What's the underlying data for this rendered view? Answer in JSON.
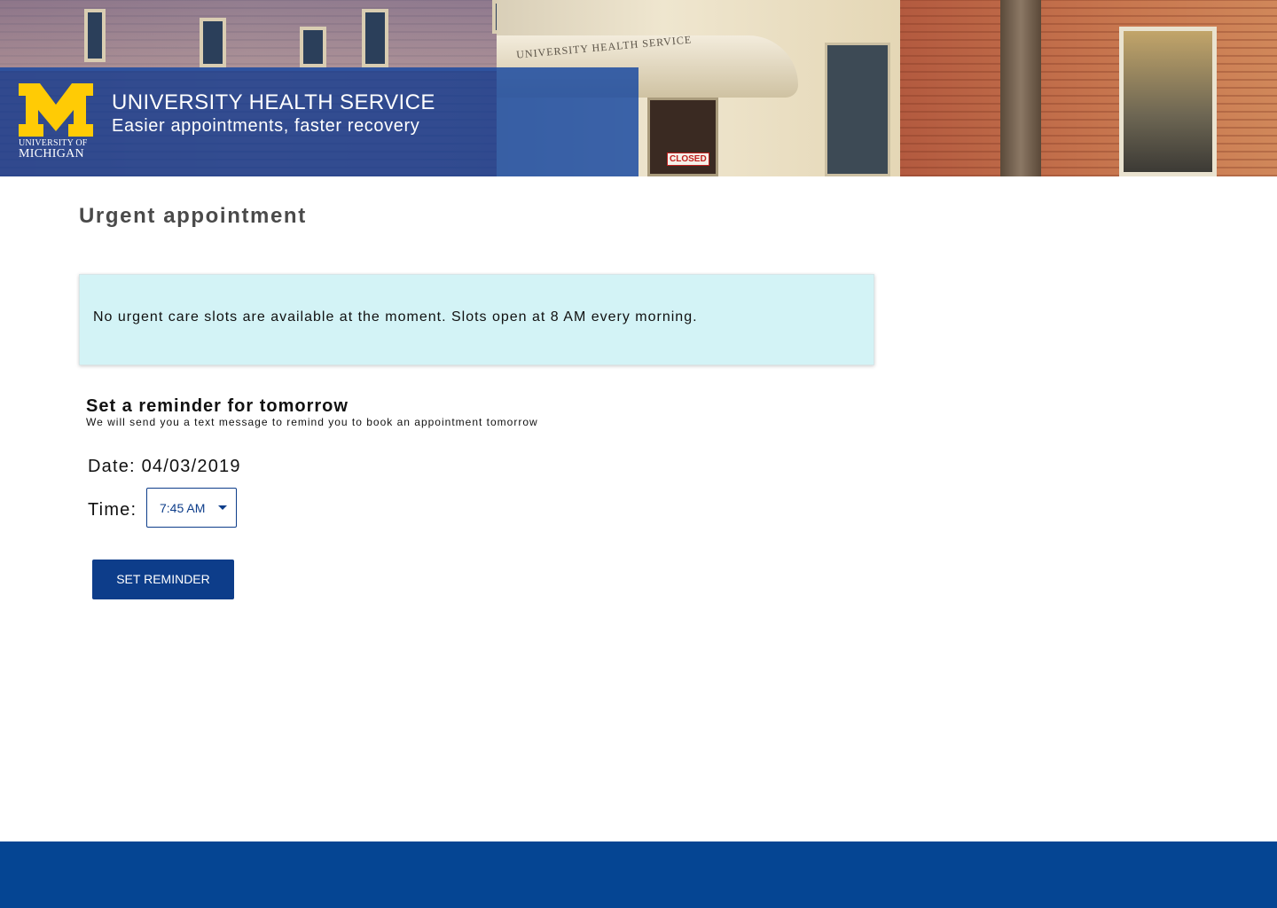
{
  "header": {
    "logo_line1": "UNIVERSITY OF",
    "logo_line2": "MICHIGAN",
    "logo_letter": "M",
    "title": "UNIVERSITY HEALTH SERVICE",
    "subtitle": "Easier appointments, faster recovery",
    "building_inscription": "UNIVERSITY HEALTH SERVICE",
    "door_sign": "CLOSED"
  },
  "main": {
    "page_title": "Urgent appointment",
    "alert": {
      "message": "No urgent care slots are available at the moment. Slots open at 8 AM every morning."
    },
    "reminder": {
      "title": "Set a reminder for tomorrow",
      "subtitle": "We will send you a text message to remind you to book an appointment tomorrow",
      "date_label": "Date:",
      "date_value": "04/03/2019",
      "time_label": "Time:",
      "time_value": "7:45 AM",
      "button_label": "SET REMINDER"
    }
  },
  "colors": {
    "brand_blue": "#054593",
    "overlay_blue": "#1446a0",
    "maize": "#ffcb05",
    "alert_bg": "#d3f3f6",
    "button_bg": "#0d3d8a"
  },
  "icons": {
    "logo": "block-m-logo",
    "dropdown": "caret-down-icon"
  }
}
